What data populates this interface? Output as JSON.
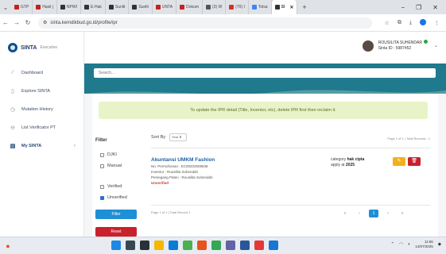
{
  "browser": {
    "tabs": [
      {
        "label": "GTP",
        "color": "#c5221f"
      },
      {
        "label": "Hasil j",
        "color": "#c5221f"
      },
      {
        "label": "NPWI",
        "color": "#333333"
      },
      {
        "label": "E-Hak",
        "color": "#333333"
      },
      {
        "label": "Sunlit",
        "color": "#333333"
      },
      {
        "label": "Sunlit",
        "color": "#333333"
      },
      {
        "label": "UNTA",
        "color": "#c5221f"
      },
      {
        "label": "Dokum",
        "color": "#c5221f"
      },
      {
        "label": "(3) W",
        "color": "#555555"
      },
      {
        "label": "(70) I",
        "color": "#d93025"
      },
      {
        "label": "Tolsa",
        "color": "#4285f4"
      },
      {
        "label": "SI",
        "color": "#333333",
        "active": true
      }
    ],
    "new_tab": "+",
    "url": "sinta.kemdikbud.go.id/profile/ipr"
  },
  "app": {
    "brand": "SINTA",
    "brand_sub": "Executive",
    "menu": [
      {
        "label": "Dashboard",
        "icon": "chart-icon"
      },
      {
        "label": "Explore SINTA",
        "icon": "document-icon"
      },
      {
        "label": "Mutation History",
        "icon": "history-icon"
      },
      {
        "label": "List Verificator PT",
        "icon": "list-icon"
      },
      {
        "label": "My SINTA",
        "icon": "id-card-icon",
        "active": true
      }
    ],
    "user": {
      "name": "ROUSILITA SUHENDAR",
      "sinta_id": "Sinta ID : 5987452"
    },
    "search_placeholder": "Search...",
    "alert": "To update the IPR detail (Title, Inventor, etc), delete IPR first then reclaim it.",
    "filter": {
      "title": "Filter",
      "options": [
        {
          "label": "DJKI",
          "checked": false
        },
        {
          "label": "Manual",
          "checked": false
        },
        {
          "label": "Verified",
          "checked": false
        },
        {
          "label": "Unverified",
          "checked": true
        }
      ],
      "filter_button": "Filter",
      "reset_button": "Reset"
    },
    "sort": {
      "label": "Sort By",
      "value": "Year"
    },
    "page_info_top": "Page 1 of 1 | Total Records : 1",
    "ipr": {
      "title": "Akuntansi UMKM Fashion",
      "number": "No. Permohonan : EC00202508538",
      "inventor": "Inventor : Rousilita Suhendah",
      "holder": "Pemegang Paten : Rousilita Suhendah",
      "status": "Unverified",
      "category_label": "category",
      "category_value": "hak cipta",
      "apply_label": "apply at",
      "apply_value": "2025"
    },
    "page_info_bottom": "Page 1 of 1 | Total Record 1",
    "pager": [
      "«",
      "‹",
      "1",
      "›",
      "»"
    ],
    "pager_current": "1"
  },
  "taskbar": {
    "time": "11:56",
    "date": "14/07/2025"
  }
}
